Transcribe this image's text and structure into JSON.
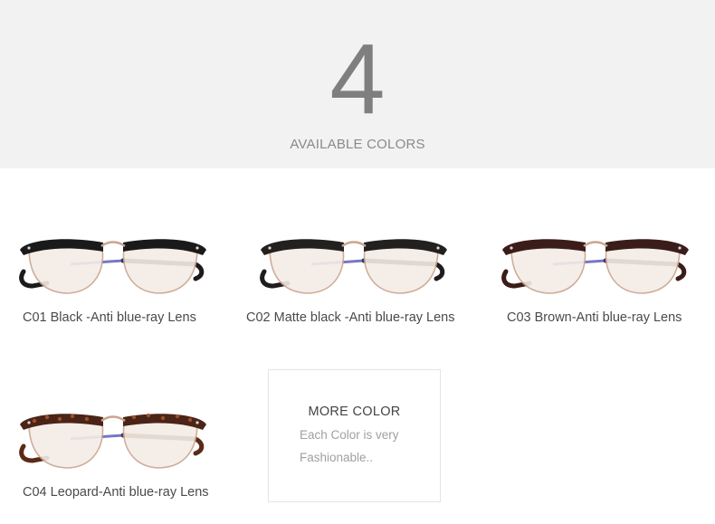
{
  "banner": {
    "number": "4",
    "subtitle": "AVAILABLE COLORS"
  },
  "products": [
    {
      "caption": "C01 Black -Anti blue-ray Lens",
      "frame_color": "#1b1a1a",
      "temple_color": "#1c1a1b",
      "variant": "black"
    },
    {
      "caption": "C02 Matte black -Anti blue-ray Lens",
      "frame_color": "#222120",
      "temple_color": "#1f1d1d",
      "variant": "matte-black"
    },
    {
      "caption": "C03 Brown-Anti blue-ray Lens",
      "frame_color": "#3a1d1a",
      "temple_color": "#3b1c18",
      "variant": "brown"
    },
    {
      "caption": "C04 Leopard-Anti blue-ray Lens",
      "frame_color": "#4a2417",
      "temple_color": "#5a2a16",
      "variant": "leopard"
    }
  ],
  "more_box": {
    "title": "MORE COLOR",
    "line1": "Each Color is very",
    "line2": "Fashionable.."
  },
  "colors": {
    "banner_bg": "#f3f2f2",
    "number_color": "#7f7f7f",
    "rim_metal": "#c9a58f",
    "lens_tint": "#f4ede6"
  }
}
